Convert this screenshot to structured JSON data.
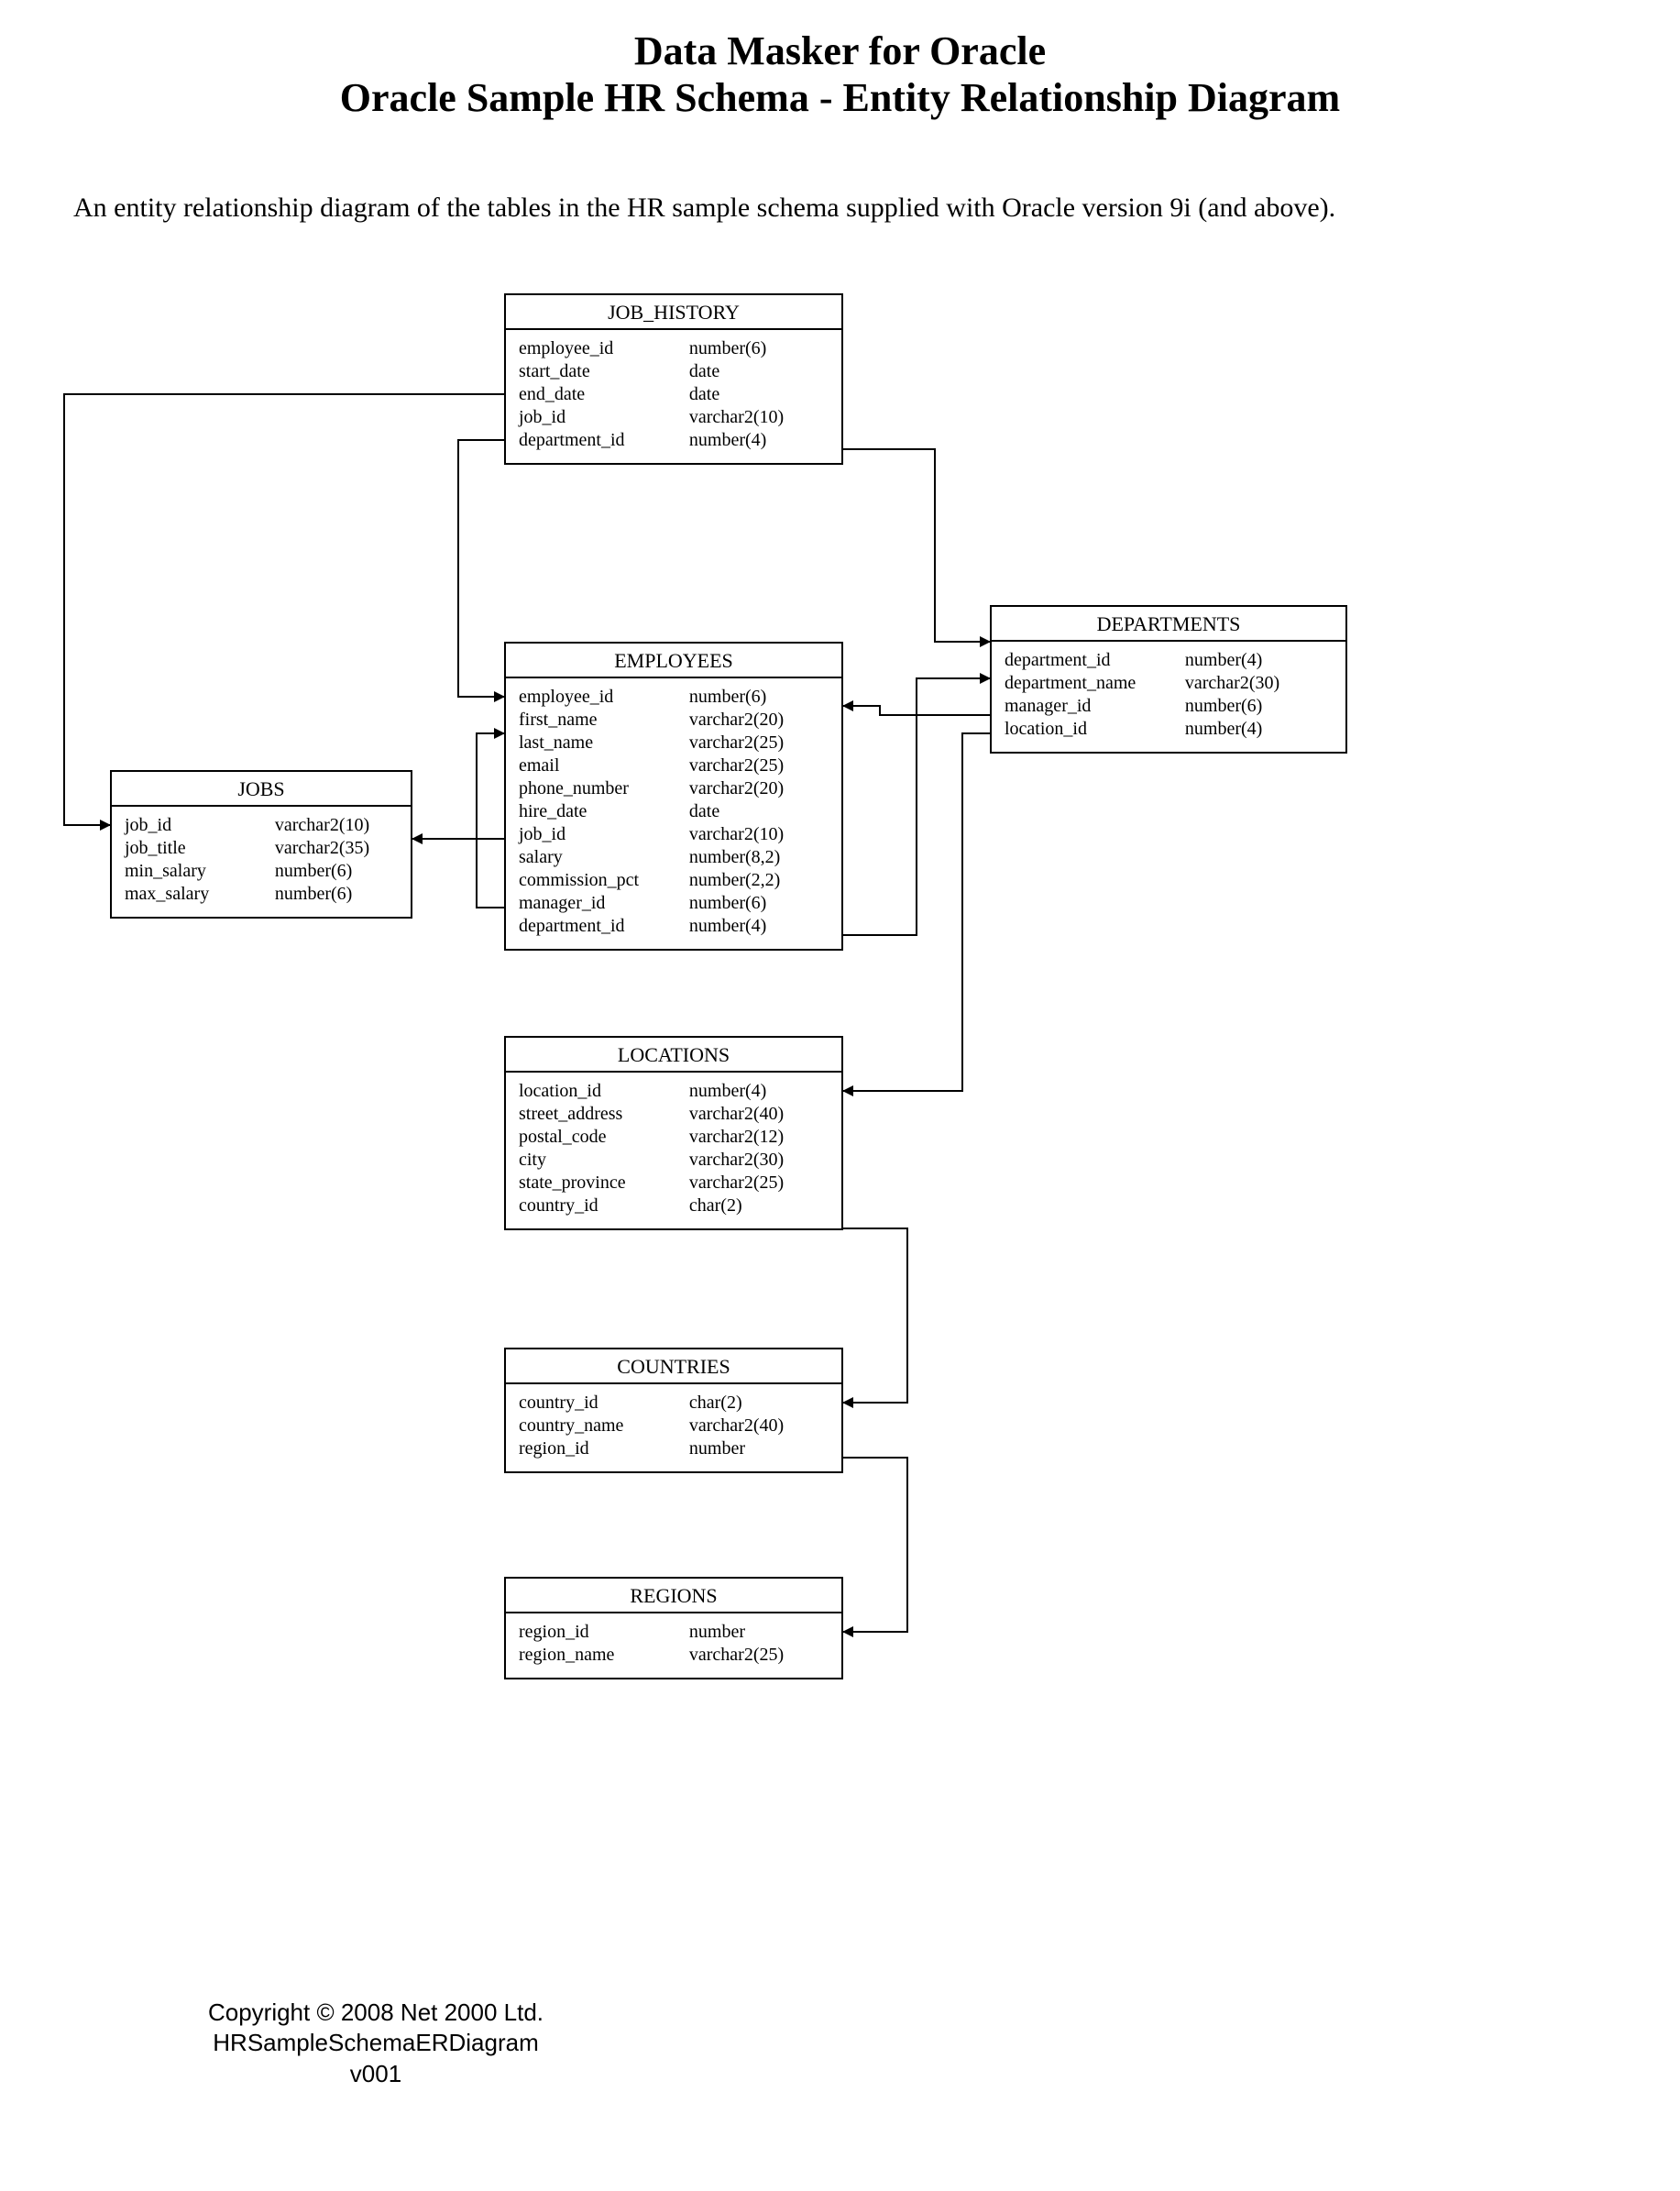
{
  "header": {
    "line1": "Data Masker for Oracle",
    "line2": "Oracle Sample HR Schema - Entity Relationship Diagram"
  },
  "intro": "An entity relationship diagram of the tables in the HR sample schema supplied with Oracle version 9i (and above).",
  "entities": {
    "job_history": {
      "title": "JOB_HISTORY",
      "cols": [
        {
          "name": "employee_id",
          "type": "number(6)"
        },
        {
          "name": "start_date",
          "type": "date"
        },
        {
          "name": "end_date",
          "type": "date"
        },
        {
          "name": "job_id",
          "type": "varchar2(10)"
        },
        {
          "name": "department_id",
          "type": "number(4)"
        }
      ]
    },
    "employees": {
      "title": "EMPLOYEES",
      "cols": [
        {
          "name": "employee_id",
          "type": "number(6)"
        },
        {
          "name": "first_name",
          "type": "varchar2(20)"
        },
        {
          "name": "last_name",
          "type": "varchar2(25)"
        },
        {
          "name": "email",
          "type": "varchar2(25)"
        },
        {
          "name": "phone_number",
          "type": "varchar2(20)"
        },
        {
          "name": "hire_date",
          "type": "date"
        },
        {
          "name": "job_id",
          "type": "varchar2(10)"
        },
        {
          "name": "salary",
          "type": "number(8,2)"
        },
        {
          "name": "commission_pct",
          "type": "number(2,2)"
        },
        {
          "name": "manager_id",
          "type": "number(6)"
        },
        {
          "name": "department_id",
          "type": "number(4)"
        }
      ]
    },
    "jobs": {
      "title": "JOBS",
      "cols": [
        {
          "name": "job_id",
          "type": "varchar2(10)"
        },
        {
          "name": "job_title",
          "type": "varchar2(35)"
        },
        {
          "name": "min_salary",
          "type": "number(6)"
        },
        {
          "name": "max_salary",
          "type": "number(6)"
        }
      ]
    },
    "departments": {
      "title": "DEPARTMENTS",
      "cols": [
        {
          "name": "department_id",
          "type": "number(4)"
        },
        {
          "name": "department_name",
          "type": "varchar2(30)"
        },
        {
          "name": "manager_id",
          "type": "number(6)"
        },
        {
          "name": "location_id",
          "type": "number(4)"
        }
      ]
    },
    "locations": {
      "title": "LOCATIONS",
      "cols": [
        {
          "name": "location_id",
          "type": "number(4)"
        },
        {
          "name": "street_address",
          "type": "varchar2(40)"
        },
        {
          "name": "postal_code",
          "type": "varchar2(12)"
        },
        {
          "name": "city",
          "type": "varchar2(30)"
        },
        {
          "name": "state_province",
          "type": "varchar2(25)"
        },
        {
          "name": "country_id",
          "type": "char(2)"
        }
      ]
    },
    "countries": {
      "title": "COUNTRIES",
      "cols": [
        {
          "name": "country_id",
          "type": "char(2)"
        },
        {
          "name": "country_name",
          "type": "varchar2(40)"
        },
        {
          "name": "region_id",
          "type": "number"
        }
      ]
    },
    "regions": {
      "title": "REGIONS",
      "cols": [
        {
          "name": "region_id",
          "type": "number"
        },
        {
          "name": "region_name",
          "type": "varchar2(25)"
        }
      ]
    }
  },
  "footer": {
    "copyright": "Copyright © 2008 Net 2000 Ltd.",
    "docname": "HRSampleSchemaERDiagram",
    "version": "v001"
  },
  "relationships": [
    {
      "from": "JOB_HISTORY.job_id",
      "to": "JOBS.job_id"
    },
    {
      "from": "JOB_HISTORY.employee_id",
      "to": "EMPLOYEES.employee_id"
    },
    {
      "from": "JOB_HISTORY.department_id",
      "to": "DEPARTMENTS.department_id"
    },
    {
      "from": "EMPLOYEES.job_id",
      "to": "JOBS.job_id"
    },
    {
      "from": "EMPLOYEES.manager_id",
      "to": "EMPLOYEES.employee_id"
    },
    {
      "from": "EMPLOYEES.department_id",
      "to": "DEPARTMENTS.department_id"
    },
    {
      "from": "DEPARTMENTS.manager_id",
      "to": "EMPLOYEES.employee_id"
    },
    {
      "from": "DEPARTMENTS.location_id",
      "to": "LOCATIONS.location_id"
    },
    {
      "from": "LOCATIONS.country_id",
      "to": "COUNTRIES.country_id"
    },
    {
      "from": "COUNTRIES.region_id",
      "to": "REGIONS.region_id"
    }
  ]
}
